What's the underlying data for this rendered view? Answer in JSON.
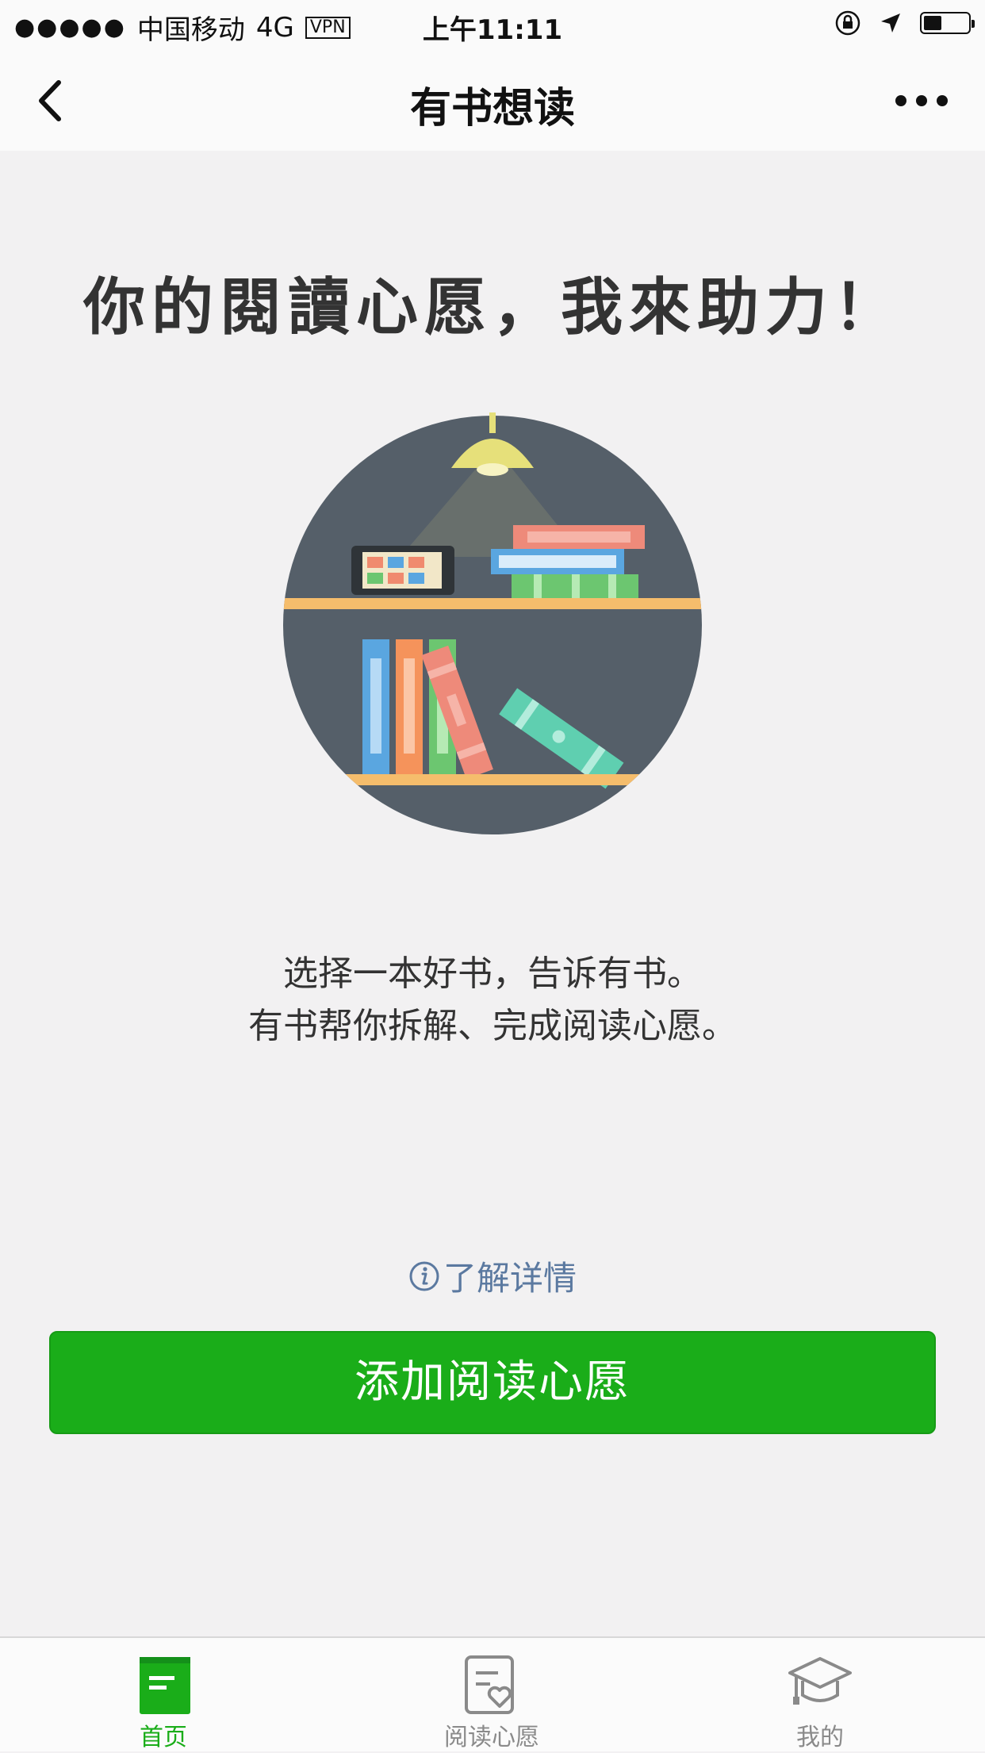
{
  "status_bar": {
    "signal": "●●●●●",
    "carrier": "中国移动",
    "network": "4G",
    "vpn": "VPN",
    "time": "上午11:11"
  },
  "nav": {
    "title": "有书想读"
  },
  "main": {
    "headline": "你的閱讀心愿，我來助力！",
    "description_line1": "选择一本好书，告诉有书。",
    "description_line2": "有书帮你拆解、完成阅读心愿。",
    "learn_more": "了解详情",
    "primary_button": "添加阅读心愿"
  },
  "tabbar": {
    "items": [
      {
        "label": "首页",
        "icon": "book-icon",
        "active": true
      },
      {
        "label": "阅读心愿",
        "icon": "wish-list-icon",
        "active": false
      },
      {
        "label": "我的",
        "icon": "graduation-cap-icon",
        "active": false
      }
    ]
  },
  "colors": {
    "accent": "#1aad19",
    "link": "#5b79a0",
    "background": "#f2f1f2"
  }
}
